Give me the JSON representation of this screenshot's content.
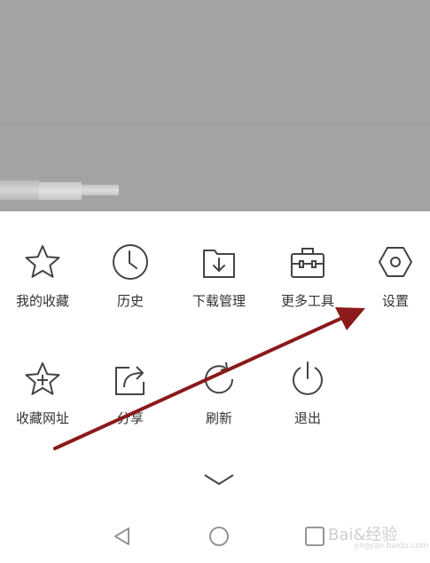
{
  "menu": {
    "row1": [
      {
        "label": "我的收藏",
        "icon": "star-icon"
      },
      {
        "label": "历史",
        "icon": "clock-icon"
      },
      {
        "label": "下载管理",
        "icon": "download-folder-icon"
      },
      {
        "label": "更多工具",
        "icon": "toolbox-icon"
      },
      {
        "label": "设置",
        "icon": "hexagon-settings-icon"
      }
    ],
    "row2": [
      {
        "label": "收藏网址",
        "icon": "star-plus-icon"
      },
      {
        "label": "分享",
        "icon": "share-icon"
      },
      {
        "label": "刷新",
        "icon": "refresh-icon"
      },
      {
        "label": "退出",
        "icon": "power-icon"
      }
    ]
  },
  "watermark": {
    "text": "Bai&经验",
    "sub": "jingyan.baidu.com"
  },
  "colors": {
    "arrow": "#8b1a1a",
    "overlay": "#a3a3a3",
    "icon": "#444444"
  }
}
